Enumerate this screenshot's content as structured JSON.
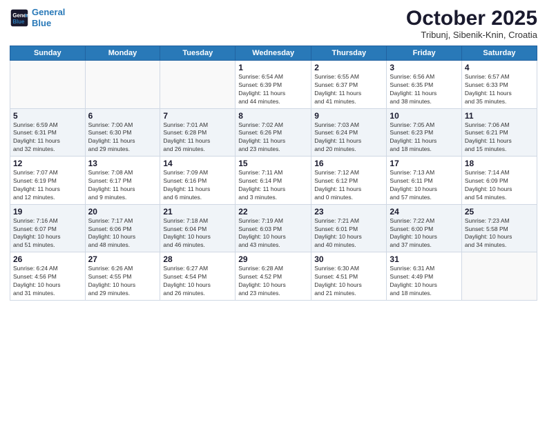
{
  "header": {
    "logo_line1": "General",
    "logo_line2": "Blue",
    "month_title": "October 2025",
    "subtitle": "Tribunj, Sibenik-Knin, Croatia"
  },
  "days_of_week": [
    "Sunday",
    "Monday",
    "Tuesday",
    "Wednesday",
    "Thursday",
    "Friday",
    "Saturday"
  ],
  "weeks": [
    [
      {
        "day": "",
        "info": ""
      },
      {
        "day": "",
        "info": ""
      },
      {
        "day": "",
        "info": ""
      },
      {
        "day": "1",
        "info": "Sunrise: 6:54 AM\nSunset: 6:39 PM\nDaylight: 11 hours\nand 44 minutes."
      },
      {
        "day": "2",
        "info": "Sunrise: 6:55 AM\nSunset: 6:37 PM\nDaylight: 11 hours\nand 41 minutes."
      },
      {
        "day": "3",
        "info": "Sunrise: 6:56 AM\nSunset: 6:35 PM\nDaylight: 11 hours\nand 38 minutes."
      },
      {
        "day": "4",
        "info": "Sunrise: 6:57 AM\nSunset: 6:33 PM\nDaylight: 11 hours\nand 35 minutes."
      }
    ],
    [
      {
        "day": "5",
        "info": "Sunrise: 6:59 AM\nSunset: 6:31 PM\nDaylight: 11 hours\nand 32 minutes."
      },
      {
        "day": "6",
        "info": "Sunrise: 7:00 AM\nSunset: 6:30 PM\nDaylight: 11 hours\nand 29 minutes."
      },
      {
        "day": "7",
        "info": "Sunrise: 7:01 AM\nSunset: 6:28 PM\nDaylight: 11 hours\nand 26 minutes."
      },
      {
        "day": "8",
        "info": "Sunrise: 7:02 AM\nSunset: 6:26 PM\nDaylight: 11 hours\nand 23 minutes."
      },
      {
        "day": "9",
        "info": "Sunrise: 7:03 AM\nSunset: 6:24 PM\nDaylight: 11 hours\nand 20 minutes."
      },
      {
        "day": "10",
        "info": "Sunrise: 7:05 AM\nSunset: 6:23 PM\nDaylight: 11 hours\nand 18 minutes."
      },
      {
        "day": "11",
        "info": "Sunrise: 7:06 AM\nSunset: 6:21 PM\nDaylight: 11 hours\nand 15 minutes."
      }
    ],
    [
      {
        "day": "12",
        "info": "Sunrise: 7:07 AM\nSunset: 6:19 PM\nDaylight: 11 hours\nand 12 minutes."
      },
      {
        "day": "13",
        "info": "Sunrise: 7:08 AM\nSunset: 6:17 PM\nDaylight: 11 hours\nand 9 minutes."
      },
      {
        "day": "14",
        "info": "Sunrise: 7:09 AM\nSunset: 6:16 PM\nDaylight: 11 hours\nand 6 minutes."
      },
      {
        "day": "15",
        "info": "Sunrise: 7:11 AM\nSunset: 6:14 PM\nDaylight: 11 hours\nand 3 minutes."
      },
      {
        "day": "16",
        "info": "Sunrise: 7:12 AM\nSunset: 6:12 PM\nDaylight: 11 hours\nand 0 minutes."
      },
      {
        "day": "17",
        "info": "Sunrise: 7:13 AM\nSunset: 6:11 PM\nDaylight: 10 hours\nand 57 minutes."
      },
      {
        "day": "18",
        "info": "Sunrise: 7:14 AM\nSunset: 6:09 PM\nDaylight: 10 hours\nand 54 minutes."
      }
    ],
    [
      {
        "day": "19",
        "info": "Sunrise: 7:16 AM\nSunset: 6:07 PM\nDaylight: 10 hours\nand 51 minutes."
      },
      {
        "day": "20",
        "info": "Sunrise: 7:17 AM\nSunset: 6:06 PM\nDaylight: 10 hours\nand 48 minutes."
      },
      {
        "day": "21",
        "info": "Sunrise: 7:18 AM\nSunset: 6:04 PM\nDaylight: 10 hours\nand 46 minutes."
      },
      {
        "day": "22",
        "info": "Sunrise: 7:19 AM\nSunset: 6:03 PM\nDaylight: 10 hours\nand 43 minutes."
      },
      {
        "day": "23",
        "info": "Sunrise: 7:21 AM\nSunset: 6:01 PM\nDaylight: 10 hours\nand 40 minutes."
      },
      {
        "day": "24",
        "info": "Sunrise: 7:22 AM\nSunset: 6:00 PM\nDaylight: 10 hours\nand 37 minutes."
      },
      {
        "day": "25",
        "info": "Sunrise: 7:23 AM\nSunset: 5:58 PM\nDaylight: 10 hours\nand 34 minutes."
      }
    ],
    [
      {
        "day": "26",
        "info": "Sunrise: 6:24 AM\nSunset: 4:56 PM\nDaylight: 10 hours\nand 31 minutes."
      },
      {
        "day": "27",
        "info": "Sunrise: 6:26 AM\nSunset: 4:55 PM\nDaylight: 10 hours\nand 29 minutes."
      },
      {
        "day": "28",
        "info": "Sunrise: 6:27 AM\nSunset: 4:54 PM\nDaylight: 10 hours\nand 26 minutes."
      },
      {
        "day": "29",
        "info": "Sunrise: 6:28 AM\nSunset: 4:52 PM\nDaylight: 10 hours\nand 23 minutes."
      },
      {
        "day": "30",
        "info": "Sunrise: 6:30 AM\nSunset: 4:51 PM\nDaylight: 10 hours\nand 21 minutes."
      },
      {
        "day": "31",
        "info": "Sunrise: 6:31 AM\nSunset: 4:49 PM\nDaylight: 10 hours\nand 18 minutes."
      },
      {
        "day": "",
        "info": ""
      }
    ]
  ]
}
